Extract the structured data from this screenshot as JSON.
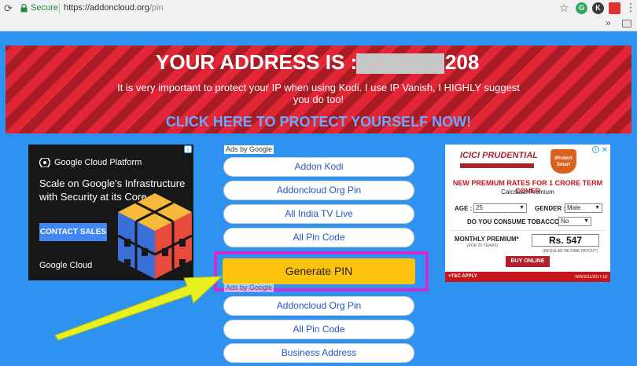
{
  "browser": {
    "secure_label": "Secure",
    "url_host": "https://addoncloud.org",
    "url_path": "/pin",
    "extensions": [
      "G",
      "K",
      "▬",
      "▪"
    ]
  },
  "banner": {
    "title_prefix": "YOUR ADDRESS IS :",
    "title_suffix": "208",
    "subtitle": "It is very important to protect your IP when using Kodi. I use IP Vanish, I HIGHLY suggest you do too!",
    "cta": "CLICK HERE TO PROTECT YOURSELF NOW!"
  },
  "ad_left": {
    "brand": "Google Cloud Platform",
    "headline": "Scale on Google's Infrastructure with Security at its Core.",
    "button": "CONTACT SALES",
    "footer": "Google Cloud"
  },
  "ads_by": "Ads by Google",
  "ad_links_top": [
    "Addon Kodi",
    "Addoncloud Org Pin",
    "All India TV Live",
    "All Pin Code"
  ],
  "generate_button": "Generate PIN",
  "ad_links_bottom": [
    "Addoncloud Org Pin",
    "All Pin Code",
    "Business Address"
  ],
  "ad_right": {
    "logo": "ICICI PRUDENTIAL",
    "shield": "iProtect Smart",
    "title": "NEW PREMIUM RATES FOR 1 CRORE TERM COVER",
    "subtitle": "Calculate Premium",
    "age_label": "AGE :",
    "age_value": "25",
    "gender_label": "GENDER :",
    "gender_value": "Male",
    "tobacco_label": "DO YOU CONSUME TOBACCO ?",
    "tobacco_value": "No",
    "premium_label": "MONTHLY PREMIUM*",
    "premium_note": "(FOR 30 YEARS)",
    "premium_value": "Rs. 547",
    "premium_sub": "(REGULAR INCOME PAYOUT)",
    "buy": "BUY ONLINE",
    "tc": "+T&C APPLY",
    "ref": "W/II/1611/2017-18"
  },
  "colors": {
    "page_bg": "#2e93f0",
    "banner_red": "#e32636",
    "highlight": "#d12cd0",
    "generate": "#fdc20c",
    "arrow": "#e8f020"
  }
}
